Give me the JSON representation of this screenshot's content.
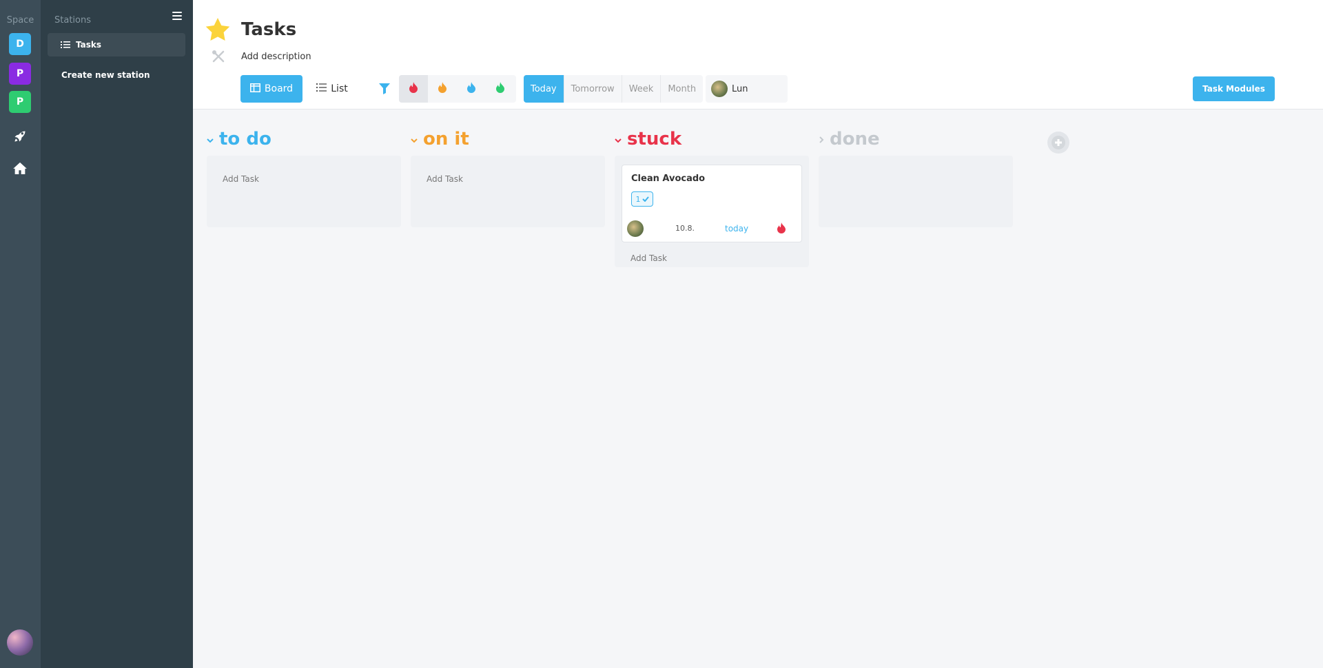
{
  "rail": {
    "title": "Space",
    "spaces": [
      {
        "letter": "D",
        "color": "#3cb3ed"
      },
      {
        "letter": "P",
        "color": "#8a2be2"
      },
      {
        "letter": "P",
        "color": "#2ecc71"
      }
    ],
    "icons": [
      "rocket-icon",
      "home-icon"
    ]
  },
  "stations": {
    "title": "Stations",
    "items": [
      {
        "label": "Tasks",
        "icon": "tasks-icon"
      }
    ],
    "create_label": "Create new station"
  },
  "header": {
    "title": "Tasks",
    "description_placeholder": "Add description",
    "views": {
      "board": "Board",
      "list": "List"
    },
    "priorities": [
      {
        "name": "high",
        "color": "#e8334a"
      },
      {
        "name": "medium",
        "color": "#f4a12f"
      },
      {
        "name": "low",
        "color": "#3cb3ed"
      },
      {
        "name": "none",
        "color": "#2ecc71"
      }
    ],
    "date_filters": [
      "Today",
      "Tomorrow",
      "Week",
      "Month"
    ],
    "active_date_filter": "Today",
    "user_filter": "Lun",
    "task_modules_label": "Task Modules"
  },
  "board": {
    "columns": [
      {
        "title": "to do",
        "color": "#3cb3ed",
        "collapsed": false,
        "add_task": "Add Task",
        "tasks": []
      },
      {
        "title": "on it",
        "color": "#f4a12f",
        "collapsed": false,
        "add_task": "Add Task",
        "tasks": []
      },
      {
        "title": "stuck",
        "color": "#e8334a",
        "collapsed": false,
        "add_task": "Add Task",
        "tasks": [
          {
            "title": "Clean Avocado",
            "checks": "1",
            "date": "10.8.",
            "due": "today",
            "priority": "high"
          }
        ]
      },
      {
        "title": "done",
        "color": "#c4c9ce",
        "collapsed": true,
        "add_task": "",
        "tasks": []
      }
    ]
  }
}
